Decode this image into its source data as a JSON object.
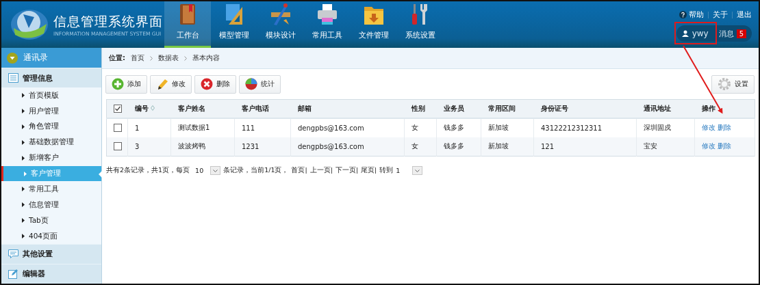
{
  "header": {
    "title": "信息管理系统界面",
    "subtitle": "INFORMATION MANAGEMENT SYSTEM GUI",
    "nav": [
      {
        "label": "工作台",
        "kind": "book",
        "selected": true
      },
      {
        "label": "模型管理",
        "kind": "ruler",
        "selected": false
      },
      {
        "label": "模块设计",
        "kind": "design",
        "selected": false
      },
      {
        "label": "常用工具",
        "kind": "printer",
        "selected": false
      },
      {
        "label": "文件管理",
        "kind": "folder",
        "selected": false
      },
      {
        "label": "系统设置",
        "kind": "tools",
        "selected": false
      }
    ],
    "links": [
      {
        "label": "帮助",
        "kind": "help"
      },
      {
        "label": "关于",
        "kind": "plain"
      },
      {
        "label": "退出",
        "kind": "plain"
      }
    ],
    "user": "ywy",
    "messages": {
      "label": "消息",
      "count": "5"
    }
  },
  "sidebar": {
    "top": "通讯录",
    "groups": [
      {
        "label": "管理信息",
        "kind": "list",
        "items": [
          {
            "label": "首页模版",
            "selected": false
          },
          {
            "label": "用户管理",
            "selected": false
          },
          {
            "label": "角色管理",
            "selected": false
          },
          {
            "label": "基础数据管理",
            "selected": false
          },
          {
            "label": "新增客户",
            "selected": false
          },
          {
            "label": "客户管理",
            "selected": true
          },
          {
            "label": "常用工具",
            "selected": false
          },
          {
            "label": "信息管理",
            "selected": false
          },
          {
            "label": "Tab页",
            "selected": false
          },
          {
            "label": "404页面",
            "selected": false
          }
        ]
      },
      {
        "label": "其他设置",
        "kind": "chat"
      },
      {
        "label": "编辑器",
        "kind": "edit"
      }
    ]
  },
  "breadcrumb": {
    "label": "位置:",
    "items": [
      "首页",
      "数据表",
      "基本内容"
    ]
  },
  "toolbar": [
    {
      "label": "添加",
      "kind": "add"
    },
    {
      "label": "修改",
      "kind": "edit"
    },
    {
      "label": "删除",
      "kind": "delete"
    },
    {
      "label": "统计",
      "kind": "stats"
    }
  ],
  "settings_button": "设置",
  "table": {
    "all_checked": true,
    "columns": [
      "编号",
      "客户姓名",
      "客户电话",
      "邮箱",
      "性别",
      "业务员",
      "常用区间",
      "身份证号",
      "通讯地址",
      "操作"
    ],
    "rows": [
      {
        "checked": false,
        "cells": [
          "1",
          "测试数据1",
          "111",
          "dengpbs@163.com",
          "女",
          "钱多多",
          "新加坡",
          "43122212312311",
          "深圳固戍"
        ],
        "actions": [
          "修改",
          "删除"
        ]
      },
      {
        "checked": false,
        "cells": [
          "3",
          "波波烤鸭",
          "1231",
          "dengpbs@163.com",
          "女",
          "钱多多",
          "新加坡",
          "121",
          "宝安"
        ],
        "actions": [
          "修改",
          "删除"
        ]
      }
    ]
  },
  "pagination": {
    "summary": "共有2条记录，共1页，每页",
    "page_size": "10",
    "status": "条记录，当前1/1页，",
    "links": [
      "首页|",
      "上一页|",
      "下一页|",
      "尾页|"
    ],
    "goto": "转到",
    "goto_value": "1"
  }
}
